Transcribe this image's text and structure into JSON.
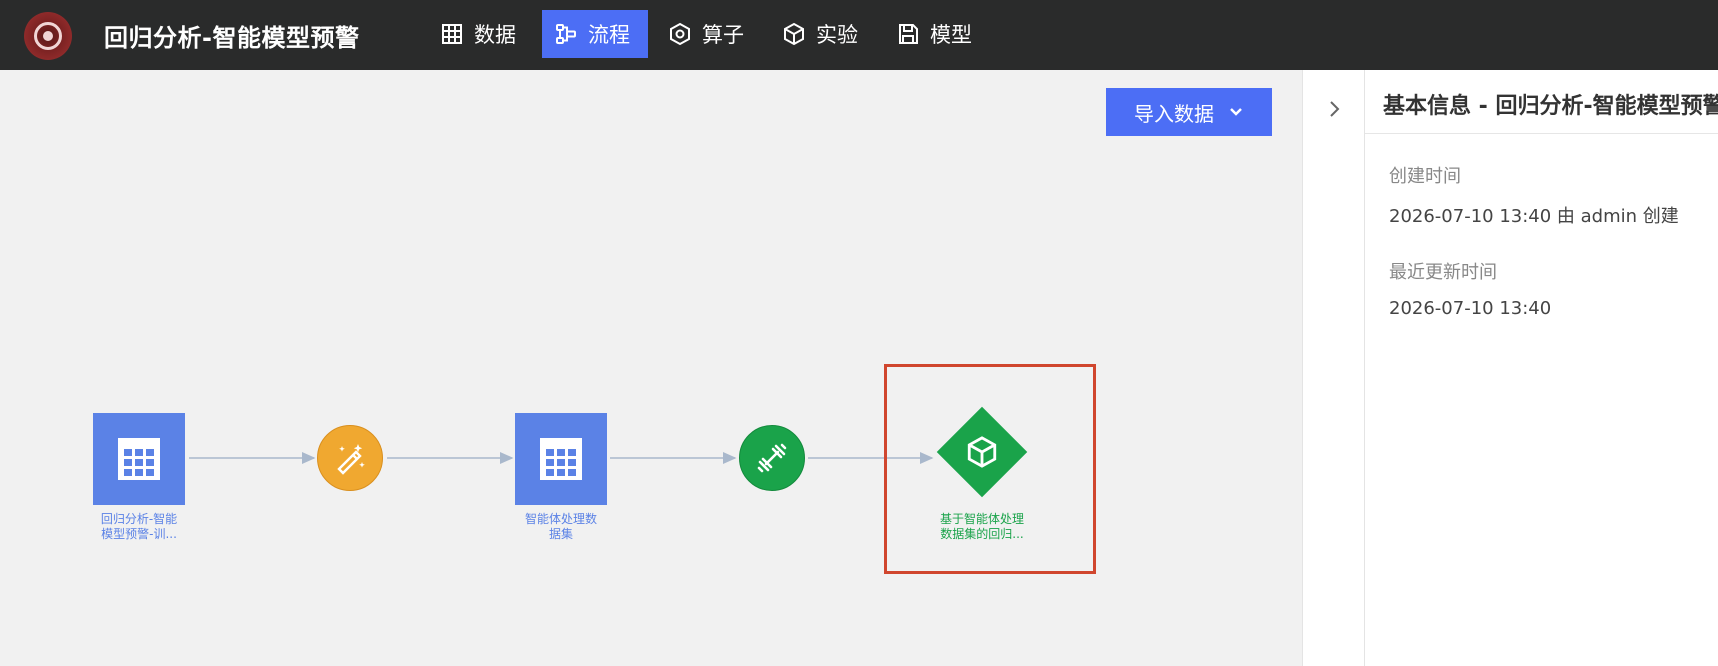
{
  "app": {
    "title": "回归分析-智能模型预警",
    "logo_icon": "target-logo-icon"
  },
  "nav": [
    {
      "label": "数据",
      "icon": "table-icon",
      "active": false
    },
    {
      "label": "流程",
      "icon": "flow-icon",
      "active": true
    },
    {
      "label": "算子",
      "icon": "hexagon-icon",
      "active": false
    },
    {
      "label": "实验",
      "icon": "cube-icon",
      "active": false
    },
    {
      "label": "模型",
      "icon": "save-icon",
      "active": false
    }
  ],
  "toolbar": {
    "import_label": "导入数据",
    "import_icon": "chevron-down-icon"
  },
  "flow": {
    "nodes": [
      {
        "label": "回归分析-智能\n模型预警-训...",
        "type": "dataset",
        "icon": "table-icon"
      },
      {
        "label": "",
        "type": "operator",
        "icon": "magic-wand-icon"
      },
      {
        "label": "智能体处理数\n据集",
        "type": "dataset",
        "icon": "table-icon"
      },
      {
        "label": "",
        "type": "train",
        "icon": "dumbbell-icon"
      },
      {
        "label": "基于智能体处理\n数据集的回归...",
        "type": "model",
        "icon": "cube-icon"
      }
    ]
  },
  "panel": {
    "title": "基本信息 - 回归分析-智能模型预警",
    "created_label": "创建时间",
    "created_value": "2026-07-10 13:40  由 admin 创建",
    "updated_label": "最近更新时间",
    "updated_value": "2026-07-10 13:40"
  },
  "colors": {
    "accent": "#4c6ef5",
    "dataset": "#5b82e6",
    "operator": "#f0a830",
    "green": "#1aa34a",
    "highlight": "#d0462e",
    "topbar": "#2a2b2b"
  }
}
